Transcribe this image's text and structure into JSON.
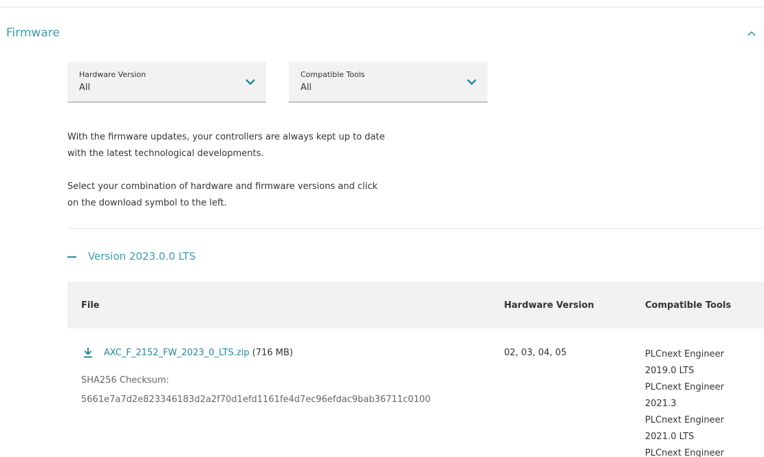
{
  "section": {
    "title": "Firmware",
    "collapse_icon": "chevron-up-icon"
  },
  "filters": {
    "hardware": {
      "label": "Hardware Version",
      "value": "All",
      "icon": "chevron-down-icon"
    },
    "tools": {
      "label": "Compatible Tools",
      "value": "All",
      "icon": "chevron-down-icon"
    }
  },
  "description": {
    "line1": "With the firmware updates, your controllers are always kept up to date",
    "line2": "with the latest technological developments.",
    "line3": "Select your combination of hardware and firmware versions and click",
    "line4": "on the download symbol to the left."
  },
  "version": {
    "icon": "minus-icon",
    "label": "Version 2023.0.0 LTS"
  },
  "table": {
    "headers": {
      "file": "File",
      "hardware": "Hardware Version",
      "tools": "Compatible Tools"
    },
    "rows": [
      {
        "download_icon": "download-icon",
        "file_name": "AXC_F_2152_FW_2023_0_LTS.zip",
        "file_size": " (716 MB)",
        "checksum_label": "SHA256 Checksum:",
        "checksum": "5661e7a7d2e823346183d2a2f70d1efd1161fe4d7ec96efdac9bab36711c0100",
        "hardware": "02, 03, 04, 05",
        "tools": [
          "PLCnext Engineer",
          "2019.0 LTS",
          "PLCnext Engineer",
          "2021.3",
          "PLCnext Engineer",
          "2021.0 LTS",
          "PLCnext Engineer"
        ]
      }
    ]
  },
  "colors": {
    "accent": "#3a9eaa",
    "link": "#1f8b99",
    "header_bg": "#f2f2f2",
    "text": "#333333"
  }
}
